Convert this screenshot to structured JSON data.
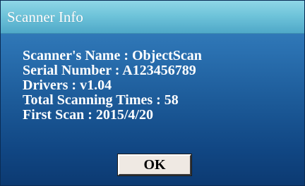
{
  "window": {
    "title": "Scanner Info"
  },
  "info": {
    "scanner_name": "Scanner's Name : ObjectScan",
    "serial_number": "Serial Number : A123456789",
    "drivers": "Drivers : v1.04",
    "total_scanning_times": "Total Scanning Times : 58",
    "first_scan": "First Scan : 2015/4/20"
  },
  "buttons": {
    "ok_label": "OK"
  },
  "colors": {
    "titlebar": "#6fc4da",
    "body_top": "#3a86c4",
    "body_bottom": "#0c3a72",
    "text": "#ffffff",
    "button_face": "#efe9e3"
  }
}
